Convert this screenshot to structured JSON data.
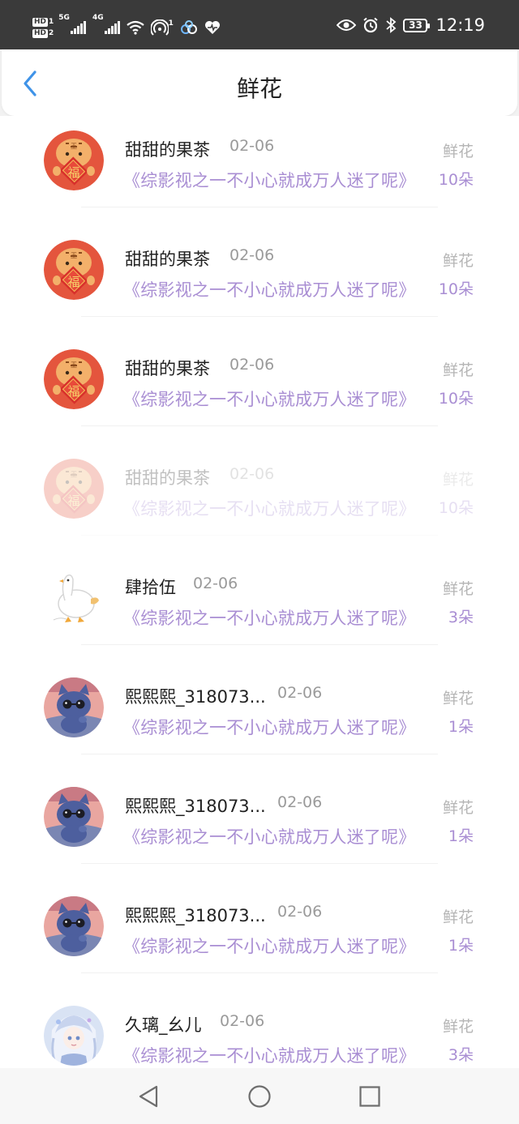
{
  "status_bar": {
    "hd1": "HD",
    "hd1_sub": "1",
    "hd2": "HD",
    "hd2_sub": "2",
    "net1": "5G",
    "net2": "4G",
    "hotspot_count": "1",
    "battery": "33",
    "time": "12:19"
  },
  "header": {
    "title": "鲜花"
  },
  "rows": [
    {
      "name": "甜甜的果茶",
      "date": "02-06",
      "book": "《综影视之一不小心就成万人迷了呢》",
      "gift": "鲜花",
      "count": "10朵",
      "avatar": "tiger-avatar"
    },
    {
      "name": "甜甜的果茶",
      "date": "02-06",
      "book": "《综影视之一不小心就成万人迷了呢》",
      "gift": "鲜花",
      "count": "10朵",
      "avatar": "tiger-avatar"
    },
    {
      "name": "甜甜的果茶",
      "date": "02-06",
      "book": "《综影视之一不小心就成万人迷了呢》",
      "gift": "鲜花",
      "count": "10朵",
      "avatar": "tiger-avatar"
    },
    {
      "name": "甜甜的果茶",
      "date": "02-06",
      "book": "《综影视之一不小心就成万人迷了呢》",
      "gift": "鲜花",
      "count": "10朵",
      "avatar": "tiger-avatar"
    },
    {
      "name": "肆拾伍",
      "date": "02-06",
      "book": "《综影视之一不小心就成万人迷了呢》",
      "gift": "鲜花",
      "count": "3朵",
      "avatar": "goose-avatar"
    },
    {
      "name": "熙熙熙_318073...",
      "date": "02-06",
      "book": "《综影视之一不小心就成万人迷了呢》",
      "gift": "鲜花",
      "count": "1朵",
      "avatar": "cat-avatar"
    },
    {
      "name": "熙熙熙_318073...",
      "date": "02-06",
      "book": "《综影视之一不小心就成万人迷了呢》",
      "gift": "鲜花",
      "count": "1朵",
      "avatar": "cat-avatar"
    },
    {
      "name": "熙熙熙_318073...",
      "date": "02-06",
      "book": "《综影视之一不小心就成万人迷了呢》",
      "gift": "鲜花",
      "count": "1朵",
      "avatar": "cat-avatar"
    },
    {
      "name": "久璃_幺儿",
      "date": "02-06",
      "book": "《综影视之一不小心就成万人迷了呢》",
      "gift": "鲜花",
      "count": "3朵",
      "avatar": "anime-girl-avatar"
    }
  ],
  "colors": {
    "accent_purple": "#a98ed3",
    "back_arrow": "#3f93e8",
    "status_bar_bg": "#3a3a3a"
  }
}
